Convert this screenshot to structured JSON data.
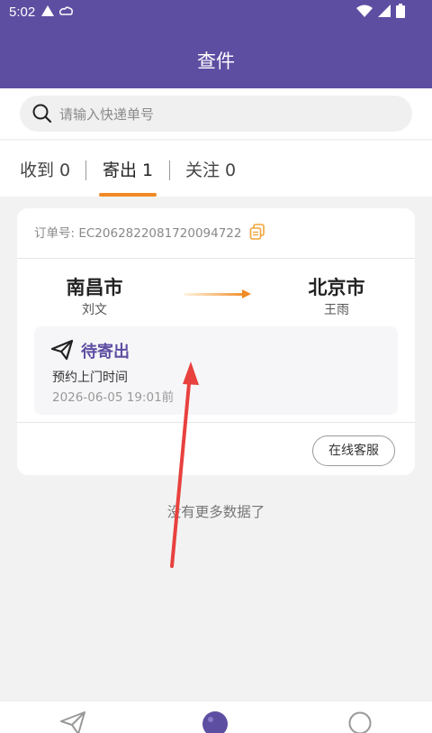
{
  "statusbar": {
    "time": "5:02"
  },
  "header": {
    "title": "查件"
  },
  "search": {
    "placeholder": "请输入快递单号"
  },
  "tabs": [
    {
      "label": "收到 0"
    },
    {
      "label": "寄出 1"
    },
    {
      "label": "关注 0"
    }
  ],
  "order": {
    "number": "订单号: EC2062822081720094722",
    "from_city": "南昌市",
    "from_person": "刘文",
    "to_city": "北京市",
    "to_person": "王雨",
    "status": "待寄出",
    "time_label": "预约上门时间",
    "time_value": "2026-06-05 19:01前",
    "service_button": "在线客服"
  },
  "footer_note": "没有更多数据了",
  "colors": {
    "brand": "#5e4ea2",
    "accent": "#f08a24",
    "annotation": "#e8413e"
  }
}
